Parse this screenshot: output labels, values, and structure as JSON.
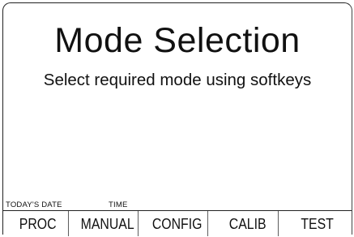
{
  "screen": {
    "title": "Mode Selection",
    "subtitle": "Select required mode using softkeys"
  },
  "status": {
    "date_label": "TODAY'S DATE",
    "time_label": "TIME"
  },
  "softkeys": [
    {
      "label": "PROC"
    },
    {
      "label": "MANUAL"
    },
    {
      "label": "CONFIG"
    },
    {
      "label": "CALIB"
    },
    {
      "label": "TEST"
    }
  ]
}
